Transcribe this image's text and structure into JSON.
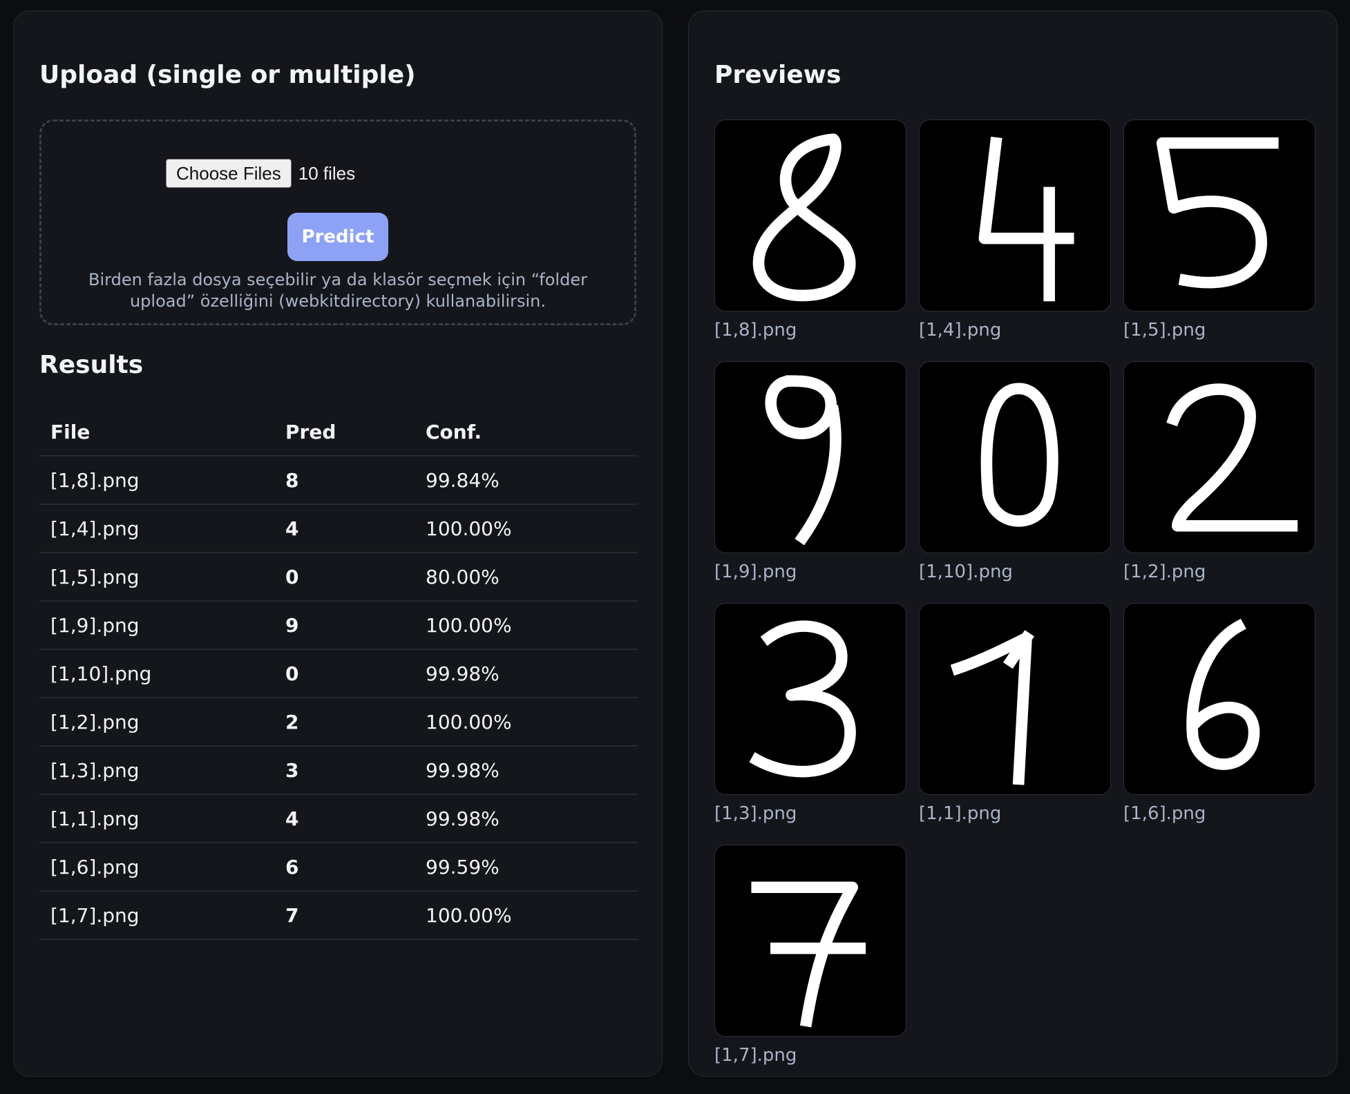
{
  "upload": {
    "title": "Upload (single or multiple)",
    "choose_files_label": "Choose Files",
    "file_count": "10 files",
    "predict_label": "Predict",
    "hint": "Birden fazla dosya seçebilir ya da klasör seçmek için “folder upload” özelliğini (webkitdirectory) kullanabilirsin."
  },
  "results": {
    "title": "Results",
    "columns": [
      "File",
      "Pred",
      "Conf."
    ],
    "rows": [
      {
        "file": "[1,8].png",
        "pred": "8",
        "conf": "99.84%"
      },
      {
        "file": "[1,4].png",
        "pred": "4",
        "conf": "100.00%"
      },
      {
        "file": "[1,5].png",
        "pred": "0",
        "conf": "80.00%"
      },
      {
        "file": "[1,9].png",
        "pred": "9",
        "conf": "100.00%"
      },
      {
        "file": "[1,10].png",
        "pred": "0",
        "conf": "99.98%"
      },
      {
        "file": "[1,2].png",
        "pred": "2",
        "conf": "100.00%"
      },
      {
        "file": "[1,3].png",
        "pred": "3",
        "conf": "99.98%"
      },
      {
        "file": "[1,1].png",
        "pred": "4",
        "conf": "99.98%"
      },
      {
        "file": "[1,6].png",
        "pred": "6",
        "conf": "99.59%"
      },
      {
        "file": "[1,7].png",
        "pred": "7",
        "conf": "100.00%"
      }
    ]
  },
  "previews": {
    "title": "Previews",
    "items": [
      {
        "caption": "[1,8].png",
        "digit": "8"
      },
      {
        "caption": "[1,4].png",
        "digit": "4"
      },
      {
        "caption": "[1,5].png",
        "digit": "5"
      },
      {
        "caption": "[1,9].png",
        "digit": "9"
      },
      {
        "caption": "[1,10].png",
        "digit": "0"
      },
      {
        "caption": "[1,2].png",
        "digit": "2"
      },
      {
        "caption": "[1,3].png",
        "digit": "3"
      },
      {
        "caption": "[1,1].png",
        "digit": "1"
      },
      {
        "caption": "[1,6].png",
        "digit": "6"
      },
      {
        "caption": "[1,7].png",
        "digit": "7"
      }
    ]
  },
  "colors": {
    "background": "#0c0d10",
    "panel": "#14161b",
    "accent": "#8ea2f5",
    "muted_text": "#aab4c8"
  }
}
